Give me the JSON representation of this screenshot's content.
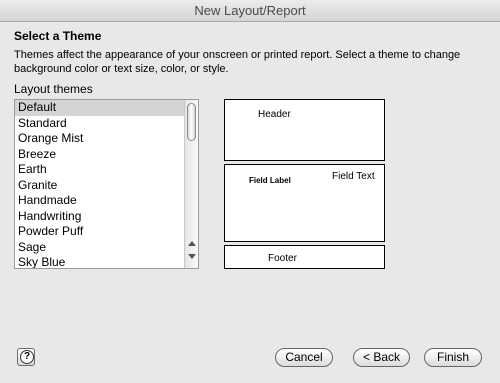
{
  "window": {
    "title": "New Layout/Report"
  },
  "section": {
    "heading": "Select a Theme",
    "description": "Themes affect the appearance of your onscreen or printed report. Select a theme to change background color or text size, color, or style."
  },
  "themes": {
    "label": "Layout themes",
    "items": [
      "Default",
      "Standard",
      "Orange Mist",
      "Breeze",
      "Earth",
      "Granite",
      "Handmade",
      "Handwriting",
      "Powder Puff",
      "Sage",
      "Sky Blue"
    ],
    "selected_index": 0
  },
  "preview": {
    "header": "Header",
    "field_label": "Field Label",
    "field_text": "Field Text",
    "footer": "Footer"
  },
  "buttons": {
    "help": "?",
    "cancel": "Cancel",
    "back": "< Back",
    "finish": "Finish"
  }
}
